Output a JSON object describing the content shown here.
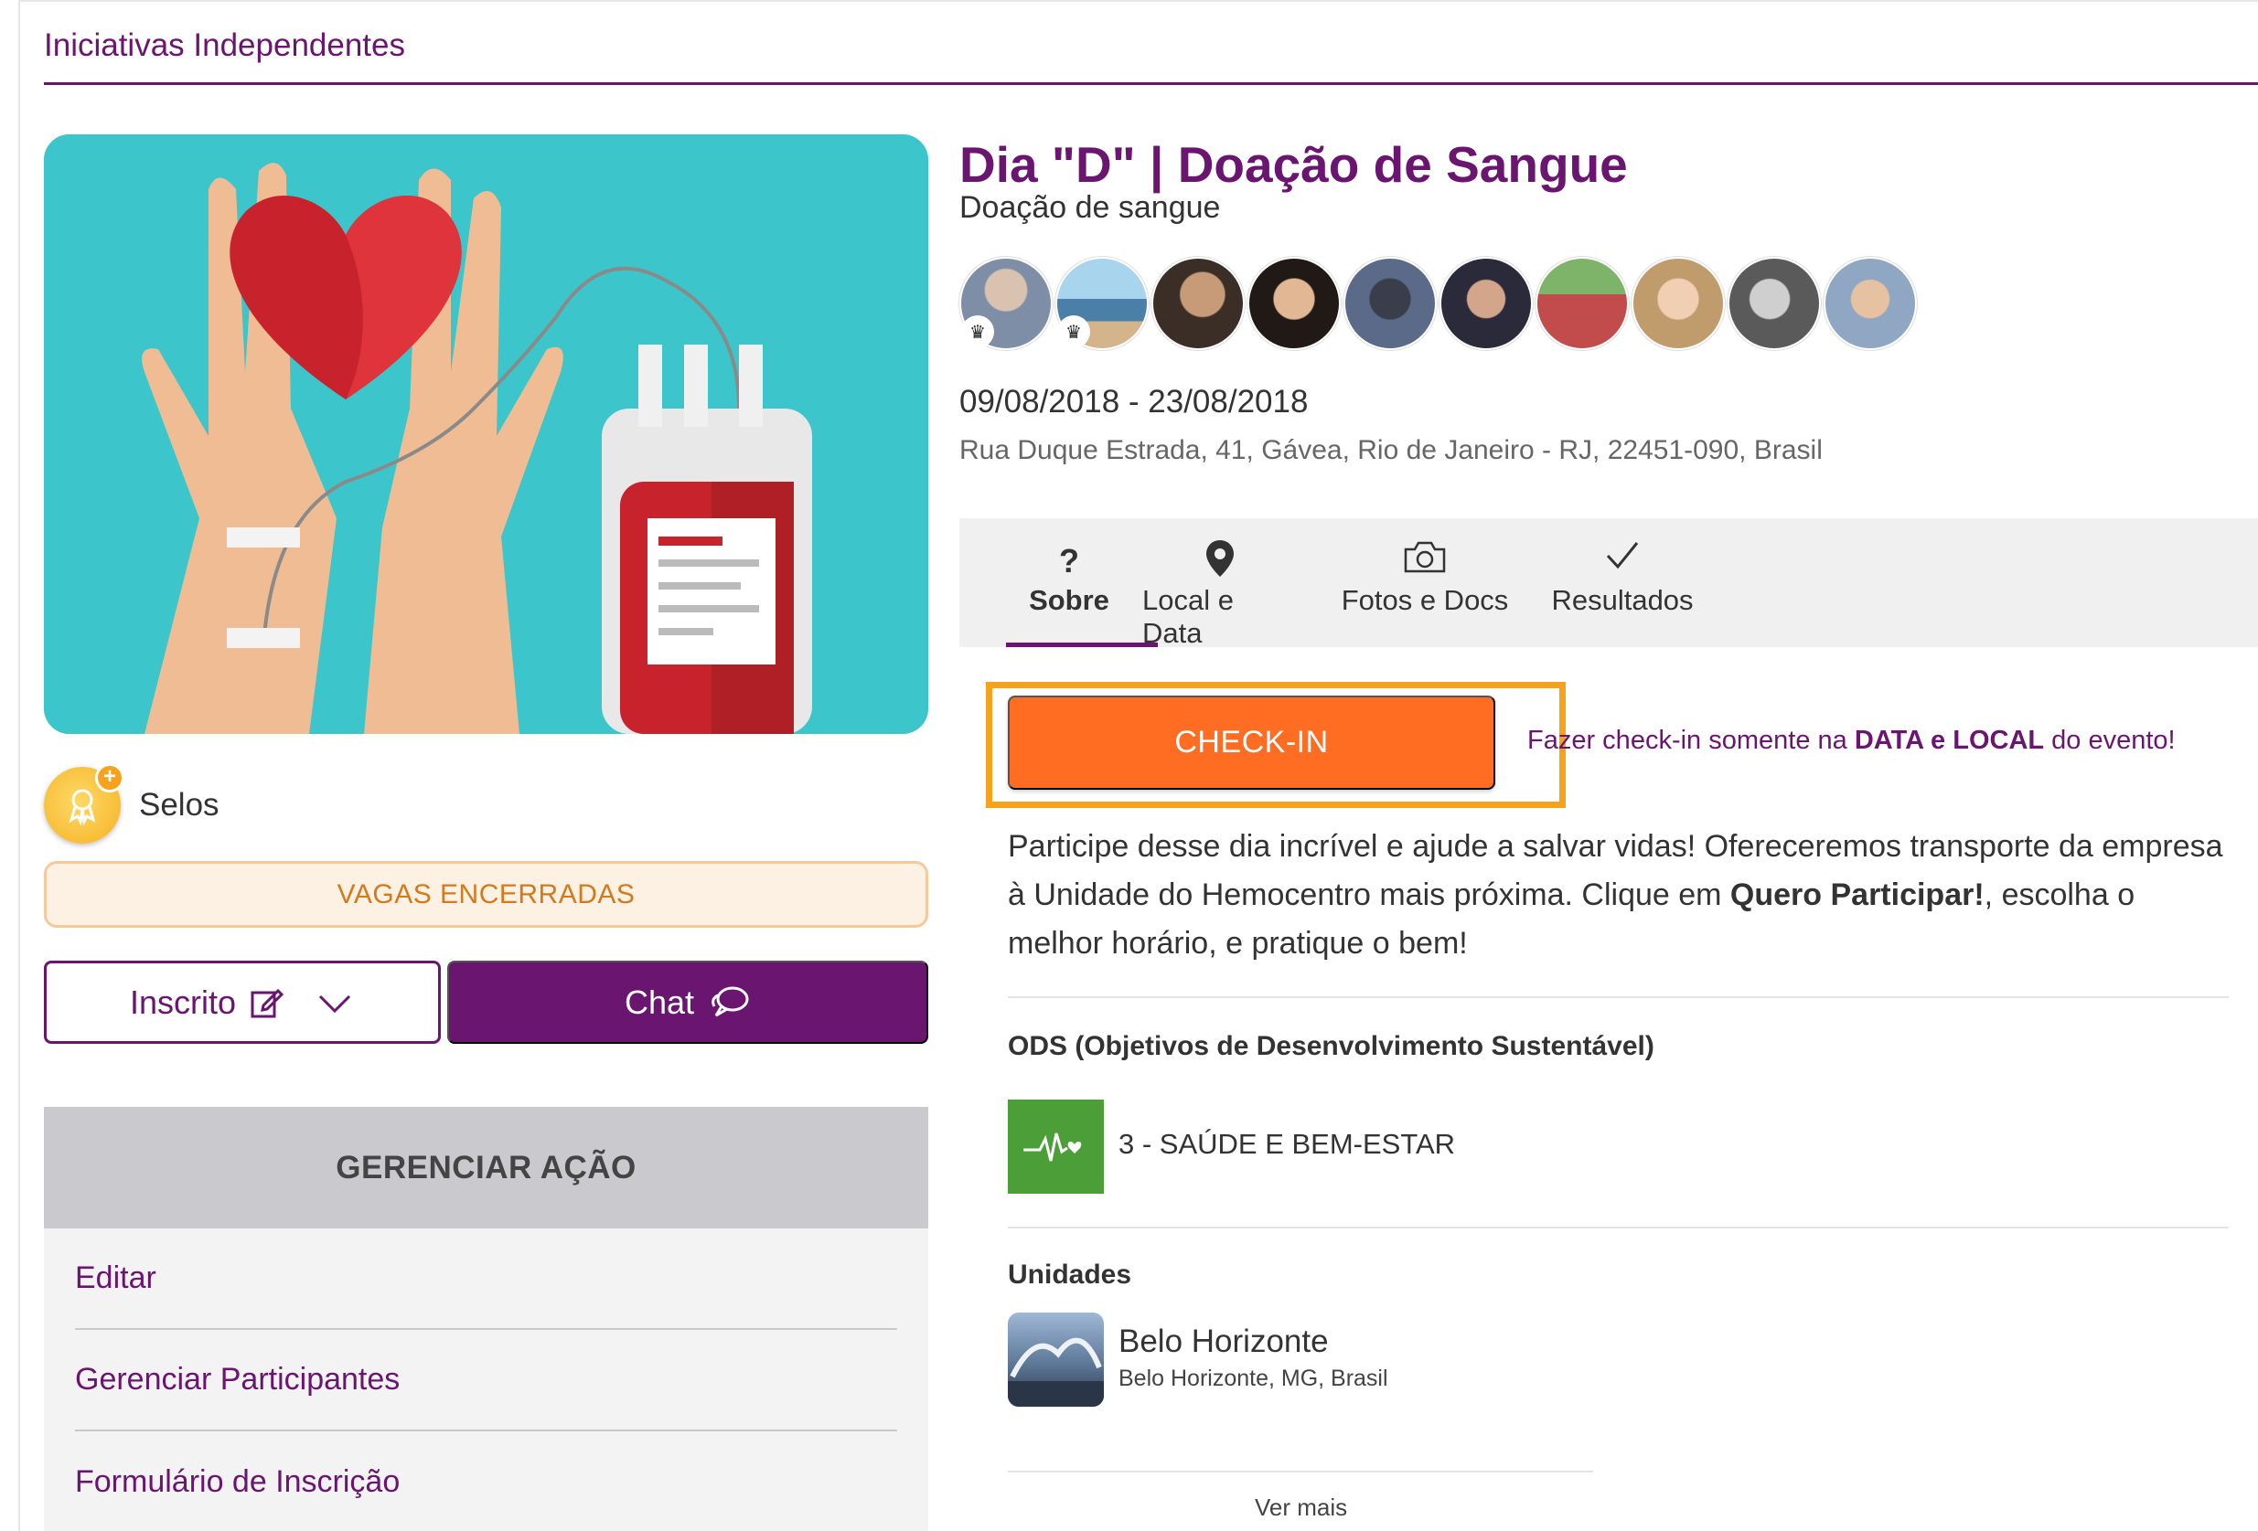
{
  "header": {
    "title": "Iniciativas Independentes"
  },
  "colors": {
    "brand_purple": "#6a1570",
    "checkin_orange": "#fe6d22",
    "highlight_orange": "#f6a21c",
    "hero_teal": "#3cc6cb",
    "ods_green": "#4c9f38"
  },
  "left": {
    "selos_label": "Selos",
    "vagas_label": "VAGAS ENCERRADAS",
    "inscrito_label": "Inscrito",
    "chat_label": "Chat",
    "manage": {
      "title": "GERENCIAR AÇÃO",
      "items": [
        "Editar",
        "Gerenciar Participantes",
        "Formulário de Inscrição"
      ]
    }
  },
  "event": {
    "title": "Dia \"D\" | Doação de Sangue",
    "subtitle": "Doação de sangue",
    "dates": "09/08/2018 - 23/08/2018",
    "address": "Rua Duque Estrada, 41, Gávea, Rio de Janeiro - RJ, 22451-090, Brasil",
    "participant_count_shown": 10
  },
  "tabs": [
    {
      "label": "Sobre",
      "icon": "question-mark-icon",
      "active": true
    },
    {
      "label": "Local e Data",
      "icon": "map-pin-icon",
      "active": false
    },
    {
      "label": "Fotos e Docs",
      "icon": "camera-icon",
      "active": false
    },
    {
      "label": "Resultados",
      "icon": "checkmark-icon",
      "active": false
    }
  ],
  "checkin": {
    "button_label": "CHECK-IN",
    "note_prefix": "Fazer check-in somente na ",
    "note_bold": "DATA e LOCAL",
    "note_suffix": " do evento!"
  },
  "description": {
    "part1": "Participe desse dia incrível e ajude a salvar vidas! Ofereceremos transporte da empresa à Unidade do Hemocentro mais próxima. Clique em ",
    "bold": "Quero Participar!",
    "part2": ", escolha o melhor horário, e pratique o bem!"
  },
  "ods": {
    "heading": "ODS (Objetivos de Desenvolvimento Sustentável)",
    "item_label": "3 - SAÚDE E BEM-ESTAR"
  },
  "units": {
    "heading": "Unidades",
    "name": "Belo Horizonte",
    "location": "Belo Horizonte, MG, Brasil"
  },
  "ver_mais": "Ver mais"
}
